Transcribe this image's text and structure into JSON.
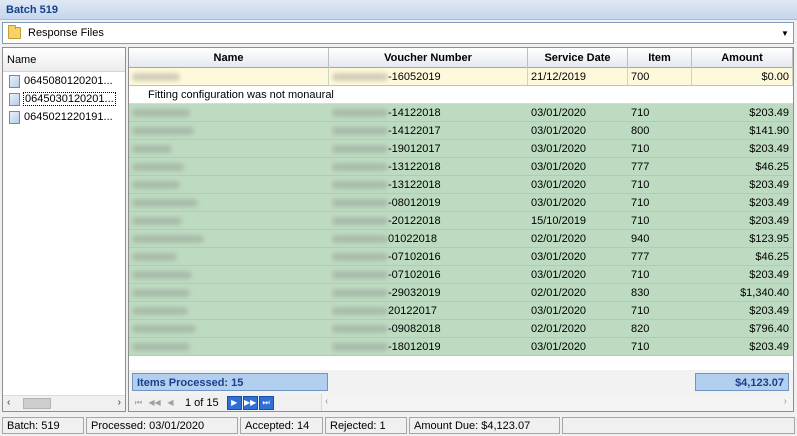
{
  "window": {
    "title": "Batch 519"
  },
  "combo": {
    "value": "Response Files"
  },
  "files": {
    "header": "Name",
    "items": [
      "0645080120201...",
      "0645030120201...",
      "0645021220191..."
    ]
  },
  "grid": {
    "columns": [
      "Name",
      "Voucher Number",
      "Service Date",
      "Item",
      "Amount"
    ],
    "rows": [
      {
        "voucher": "-16052019",
        "date": "21/12/2019",
        "item": "700",
        "amount": "$0.00"
      },
      {
        "voucher": "-14122018",
        "date": "03/01/2020",
        "item": "710",
        "amount": "$203.49"
      },
      {
        "voucher": "-14122017",
        "date": "03/01/2020",
        "item": "800",
        "amount": "$141.90"
      },
      {
        "voucher": "-19012017",
        "date": "03/01/2020",
        "item": "710",
        "amount": "$203.49"
      },
      {
        "voucher": "-13122018",
        "date": "03/01/2020",
        "item": "777",
        "amount": "$46.25"
      },
      {
        "voucher": "-13122018",
        "date": "03/01/2020",
        "item": "710",
        "amount": "$203.49"
      },
      {
        "voucher": "-08012019",
        "date": "03/01/2020",
        "item": "710",
        "amount": "$203.49"
      },
      {
        "voucher": "-20122018",
        "date": "15/10/2019",
        "item": "710",
        "amount": "$203.49"
      },
      {
        "voucher": "01022018",
        "date": "02/01/2020",
        "item": "940",
        "amount": "$123.95"
      },
      {
        "voucher": "-07102016",
        "date": "03/01/2020",
        "item": "777",
        "amount": "$46.25"
      },
      {
        "voucher": "-07102016",
        "date": "03/01/2020",
        "item": "710",
        "amount": "$203.49"
      },
      {
        "voucher": "-29032019",
        "date": "02/01/2020",
        "item": "830",
        "amount": "$1,340.40"
      },
      {
        "voucher": "20122017",
        "date": "03/01/2020",
        "item": "710",
        "amount": "$203.49"
      },
      {
        "voucher": "-09082018",
        "date": "02/01/2020",
        "item": "820",
        "amount": "$796.40"
      },
      {
        "voucher": "-18012019",
        "date": "03/01/2020",
        "item": "710",
        "amount": "$203.49"
      }
    ],
    "note": "Fitting configuration was not monaural",
    "footer": {
      "processed": "Items Processed: 15",
      "total": "$4,123.07"
    },
    "pager": {
      "text": "1 of 15"
    }
  },
  "status": {
    "batch": "Batch: 519",
    "processed": "Processed: 03/01/2020",
    "accepted": "Accepted: 14",
    "rejected": "Rejected: 1",
    "amount_due": "Amount Due: $4,123.07"
  },
  "colors": {
    "row_ok": "#bddbc0",
    "row_rejected": "#fff9db",
    "summary": "#b2cff0"
  }
}
